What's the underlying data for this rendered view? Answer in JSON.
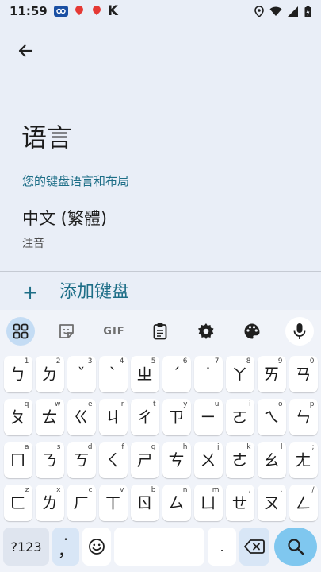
{
  "status_bar": {
    "time": "11:59",
    "notif_k": "K"
  },
  "page": {
    "title": "语言",
    "section_label": "您的键盘语言和布局",
    "language_name": "中文 (繁體)",
    "language_layout": "注音",
    "add_keyboard_label": "添加键盘"
  },
  "toolbar": {
    "gif_label": "GIF"
  },
  "keyboard": {
    "rows": [
      [
        {
          "main": "ㄅ",
          "hint": "1"
        },
        {
          "main": "ㄉ",
          "hint": "2"
        },
        {
          "main": "ˇ",
          "hint": "3"
        },
        {
          "main": "ˋ",
          "hint": "4"
        },
        {
          "main": "ㄓ",
          "hint": "5"
        },
        {
          "main": "ˊ",
          "hint": "6"
        },
        {
          "main": "˙",
          "hint": "7"
        },
        {
          "main": "ㄚ",
          "hint": "8"
        },
        {
          "main": "ㄞ",
          "hint": "9"
        },
        {
          "main": "ㄢ",
          "hint": "0"
        }
      ],
      [
        {
          "main": "ㄆ",
          "hint": "q"
        },
        {
          "main": "ㄊ",
          "hint": "w"
        },
        {
          "main": "ㄍ",
          "hint": "e"
        },
        {
          "main": "ㄐ",
          "hint": "r"
        },
        {
          "main": "ㄔ",
          "hint": "t"
        },
        {
          "main": "ㄗ",
          "hint": "y"
        },
        {
          "main": "ㄧ",
          "hint": "u"
        },
        {
          "main": "ㄛ",
          "hint": "i"
        },
        {
          "main": "ㄟ",
          "hint": "o"
        },
        {
          "main": "ㄣ",
          "hint": "p"
        }
      ],
      [
        {
          "main": "ㄇ",
          "hint": "a"
        },
        {
          "main": "ㄋ",
          "hint": "s"
        },
        {
          "main": "ㄎ",
          "hint": "d"
        },
        {
          "main": "ㄑ",
          "hint": "f"
        },
        {
          "main": "ㄕ",
          "hint": "g"
        },
        {
          "main": "ㄘ",
          "hint": "h"
        },
        {
          "main": "ㄨ",
          "hint": "j"
        },
        {
          "main": "ㄜ",
          "hint": "k"
        },
        {
          "main": "ㄠ",
          "hint": "l"
        },
        {
          "main": "ㄤ",
          "hint": ";"
        }
      ],
      [
        {
          "main": "ㄈ",
          "hint": "z"
        },
        {
          "main": "ㄌ",
          "hint": "x"
        },
        {
          "main": "ㄏ",
          "hint": "c"
        },
        {
          "main": "ㄒ",
          "hint": "v"
        },
        {
          "main": "ㄖ",
          "hint": "b"
        },
        {
          "main": "ㄙ",
          "hint": "n"
        },
        {
          "main": "ㄩ",
          "hint": "m"
        },
        {
          "main": "ㄝ",
          "hint": ","
        },
        {
          "main": "ㄡ",
          "hint": "."
        },
        {
          "main": "ㄥ",
          "hint": "/"
        }
      ]
    ],
    "symbols_label": "?123",
    "comma_label": "，",
    "phrase_label": "."
  },
  "colors": {
    "accent": "#1d6e87",
    "keyboard_bg": "#f0f3f9",
    "active_tool": "#c4dcf4",
    "enter_key": "#7fc7ef"
  }
}
